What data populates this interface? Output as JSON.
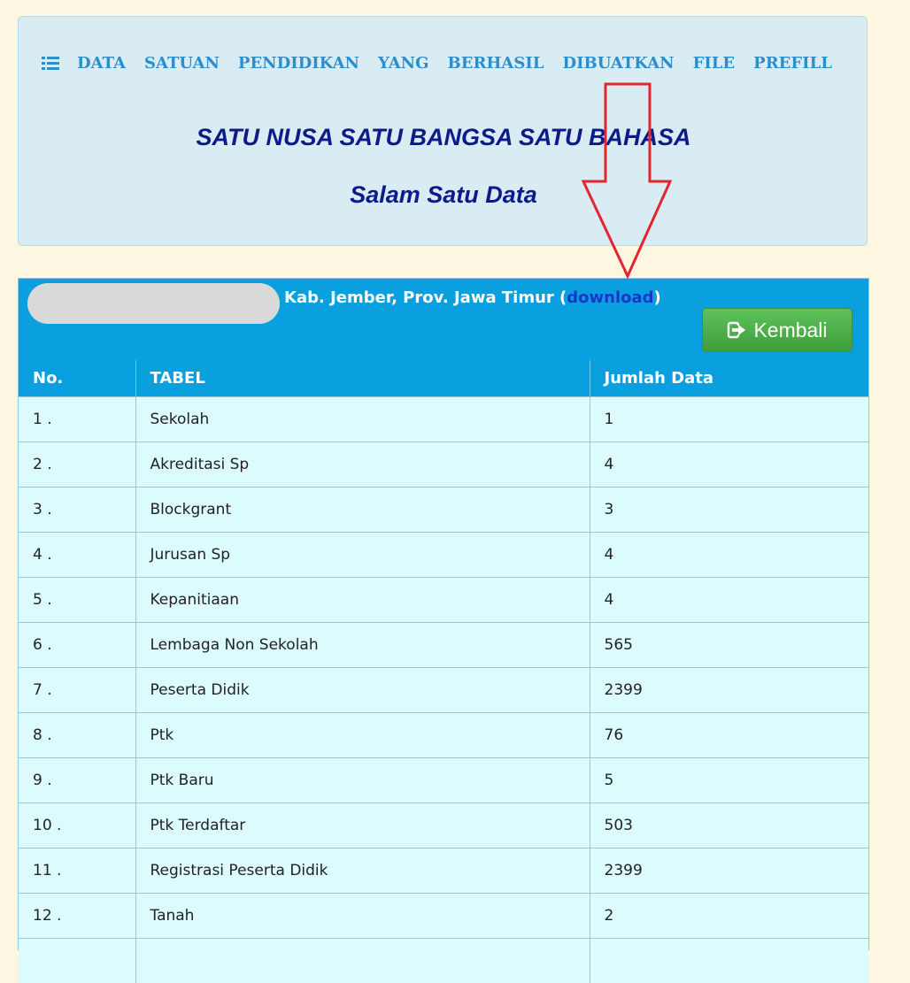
{
  "header": {
    "words": [
      "DATA",
      "SATUAN",
      "PENDIDIKAN",
      "YANG",
      "BERHASIL",
      "DIBUATKAN",
      "FILE",
      "PREFILL"
    ],
    "icon": "list-icon",
    "slogan_1": "SATU NUSA SATU BANGSA SATU BAHASA",
    "slogan_2": "Salam Satu Data"
  },
  "table_panel": {
    "location_text": "Kab. Jember, Prov. Jawa Timur (",
    "download_label": "download",
    "location_suffix": ")",
    "back_button_label": "Kembali",
    "back_button_icon": "sign-out-icon",
    "columns": [
      "No.",
      "TABEL",
      "Jumlah Data"
    ],
    "rows": [
      {
        "no": "1 .",
        "tabel": "Sekolah",
        "jumlah": "1"
      },
      {
        "no": "2 .",
        "tabel": "Akreditasi Sp",
        "jumlah": "4"
      },
      {
        "no": "3 .",
        "tabel": "Blockgrant",
        "jumlah": "3"
      },
      {
        "no": "4 .",
        "tabel": "Jurusan Sp",
        "jumlah": "4"
      },
      {
        "no": "5 .",
        "tabel": "Kepanitiaan",
        "jumlah": "4"
      },
      {
        "no": "6 .",
        "tabel": "Lembaga Non Sekolah",
        "jumlah": "565"
      },
      {
        "no": "7 .",
        "tabel": "Peserta Didik",
        "jumlah": "2399"
      },
      {
        "no": "8 .",
        "tabel": "Ptk",
        "jumlah": "76"
      },
      {
        "no": "9 .",
        "tabel": "Ptk Baru",
        "jumlah": "5"
      },
      {
        "no": "10 .",
        "tabel": "Ptk Terdaftar",
        "jumlah": "503"
      },
      {
        "no": "11 .",
        "tabel": "Registrasi Peserta Didik",
        "jumlah": "2399"
      },
      {
        "no": "12 .",
        "tabel": "Tanah",
        "jumlah": "2"
      },
      {
        "no": "",
        "tabel": "",
        "jumlah": ""
      }
    ]
  },
  "colors": {
    "page_background": "#fdf6e1",
    "header_background": "#d9ebf3",
    "header_text": "#2d8fc9",
    "slogan_text": "#0d1a8a",
    "table_header_background": "#0aa0e0",
    "table_cell_background": "#dcfbfd",
    "download_link": "#1737c9",
    "back_button": "#4cae48",
    "annotation_arrow": "#e3262e"
  }
}
